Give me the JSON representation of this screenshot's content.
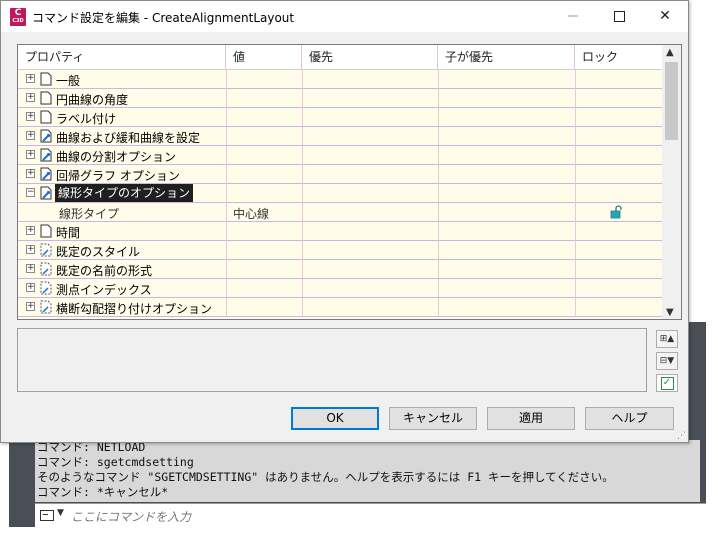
{
  "window": {
    "title": "コマンド設定を編集 - CreateAlignmentLayout",
    "app_icon_text": "C",
    "app_icon_subtext": "C3D",
    "minimize_icon": "minimize-icon",
    "close_glyph": "✕"
  },
  "grid": {
    "columns": [
      "プロパティ",
      "値",
      "優先",
      "子が優先",
      "ロック"
    ],
    "rows": [
      {
        "expander": "+",
        "label": "一般",
        "icon": "page"
      },
      {
        "expander": "+",
        "label": "円曲線の角度",
        "icon": "page"
      },
      {
        "expander": "+",
        "label": "ラベル付け",
        "icon": "page"
      },
      {
        "expander": "+",
        "label": "曲線および緩和曲線を設定",
        "icon": "page-wrench"
      },
      {
        "expander": "+",
        "label": "曲線の分割オプション",
        "icon": "page-wrench"
      },
      {
        "expander": "+",
        "label": "回帰グラフ オプション",
        "icon": "page-wrench"
      },
      {
        "expander": "−",
        "label": "線形タイプのオプション",
        "icon": "page-wrench",
        "selected": true
      },
      {
        "sub": true,
        "label": "線形タイプ",
        "value": "中心線",
        "locked": "unlocked"
      },
      {
        "expander": "+",
        "label": "時間",
        "icon": "page"
      },
      {
        "expander": "+",
        "label": "既定のスタイル",
        "icon": "dashed-page"
      },
      {
        "expander": "+",
        "label": "既定の名前の形式",
        "icon": "dashed-page"
      },
      {
        "expander": "+",
        "label": "測点インデックス",
        "icon": "dashed-page"
      },
      {
        "expander": "+",
        "label": "横断勾配摺り付けオプション",
        "icon": "dashed-page"
      }
    ],
    "scroll_up": "▲",
    "scroll_down": "▼"
  },
  "side_buttons": {
    "expand_all": "⊞▲",
    "collapse_all": "⊟▼",
    "check": "✓"
  },
  "buttons": {
    "ok": "OK",
    "cancel": "キャンセル",
    "apply": "適用",
    "help": "ヘルプ"
  },
  "command_line": {
    "history": [
      "コマンド: NETLOAD",
      "コマンド: sgetcmdsetting",
      "そのようなコマンド  \"SGETCMDSETTING\" はありません。ヘルプを表示するには  F1 キーを押してください。",
      "コマンド: *キャンセル*"
    ],
    "input_placeholder": "ここにコマンドを入力",
    "prompt_caret": "▼"
  },
  "colors": {
    "grid_background": "#fffde9",
    "selection": "#1f1f1f",
    "accent": "#0078d7",
    "command_bg": "#4a4f57"
  }
}
